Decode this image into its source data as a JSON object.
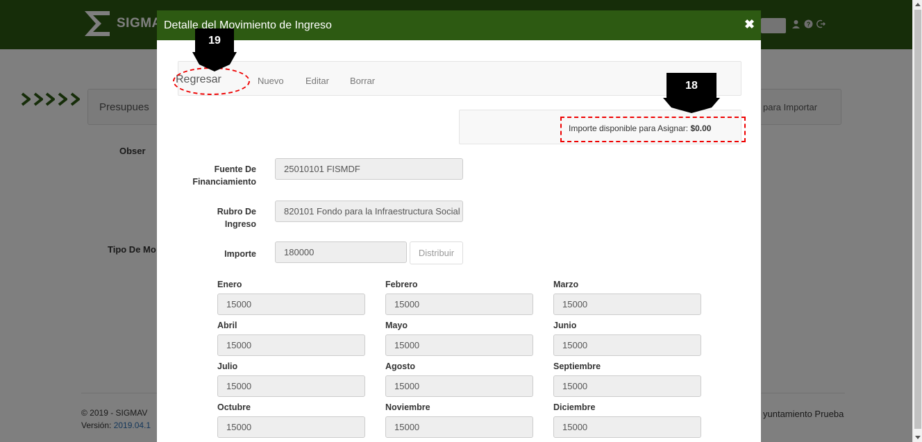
{
  "app": {
    "brand": "SIGMA",
    "panel_title": "Presupues",
    "panel_right": "para Importar",
    "label_obs": "Obser",
    "label_tipo": "Tipo De Mo",
    "footer_copy": "© 2019 - SIGMAV",
    "footer_version_label": "Versión:",
    "footer_version": "2019.04.1",
    "footer_ayuntamiento": "yuntamiento Prueba"
  },
  "modal": {
    "title": "Detalle del Movimiento de Ingreso",
    "close": "✖",
    "toolbar": {
      "regresar": "Regresar",
      "nuevo": "Nuevo",
      "editar": "Editar",
      "borrar": "Borrar"
    },
    "importe_label": "Importe disponible para Asignar:",
    "importe_value": "$0.00",
    "fuente_label_1": "Fuente De",
    "fuente_label_2": "Financiamiento",
    "fuente_value": "25010101 FISMDF",
    "rubro_label_1": "Rubro De",
    "rubro_label_2": "Ingreso",
    "rubro_value": "820101 Fondo para la Infraestructura Social",
    "importe_field_label": "Importe",
    "importe_field_value": "180000",
    "distribuir": "Distribuir",
    "months": [
      {
        "label": "Enero",
        "value": "15000"
      },
      {
        "label": "Febrero",
        "value": "15000"
      },
      {
        "label": "Marzo",
        "value": "15000"
      },
      {
        "label": "Abril",
        "value": "15000"
      },
      {
        "label": "Mayo",
        "value": "15000"
      },
      {
        "label": "Junio",
        "value": "15000"
      },
      {
        "label": "Julio",
        "value": "15000"
      },
      {
        "label": "Agosto",
        "value": "15000"
      },
      {
        "label": "Septiembre",
        "value": "15000"
      },
      {
        "label": "Octubre",
        "value": "15000"
      },
      {
        "label": "Noviembre",
        "value": "15000"
      },
      {
        "label": "Diciembre",
        "value": "15000"
      }
    ]
  },
  "annotations": {
    "callout_19": "19",
    "callout_18": "18",
    "color": "#e00000"
  }
}
